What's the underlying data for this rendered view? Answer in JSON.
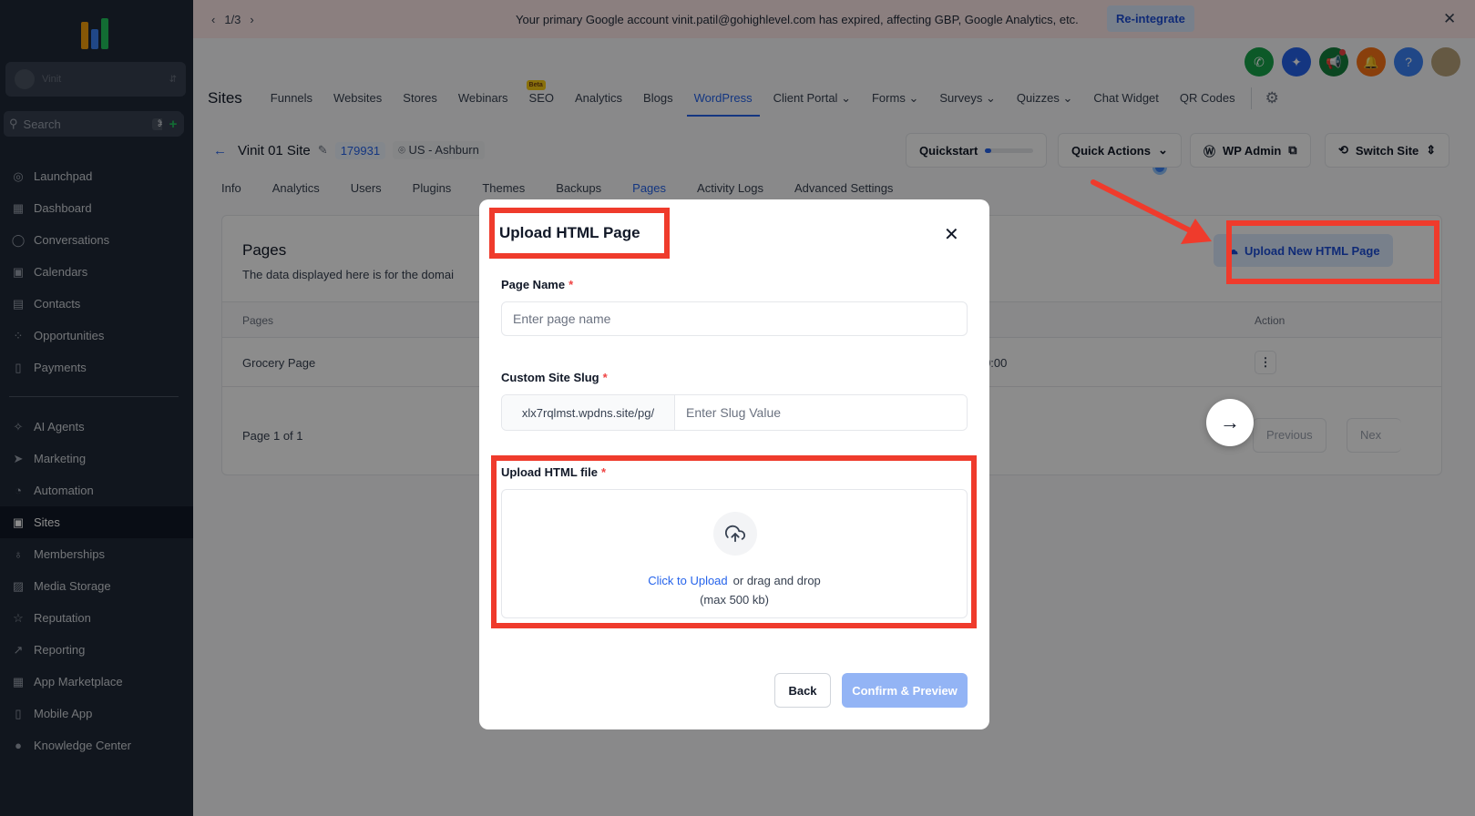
{
  "sidebar": {
    "account": {
      "name": "Vinit",
      "sub": ""
    },
    "search": {
      "placeholder": "Search",
      "shortcut": "⌘K"
    },
    "items": [
      {
        "label": "Launchpad",
        "icon": "rocket-icon"
      },
      {
        "label": "Dashboard",
        "icon": "grid-icon"
      },
      {
        "label": "Conversations",
        "icon": "chat-icon"
      },
      {
        "label": "Calendars",
        "icon": "calendar-icon"
      },
      {
        "label": "Contacts",
        "icon": "contacts-icon"
      },
      {
        "label": "Opportunities",
        "icon": "funnel-icon"
      },
      {
        "label": "Payments",
        "icon": "receipt-icon"
      },
      {
        "label": "AI Agents",
        "icon": "sparkle-icon"
      },
      {
        "label": "Marketing",
        "icon": "send-icon"
      },
      {
        "label": "Automation",
        "icon": "automation-icon"
      },
      {
        "label": "Sites",
        "icon": "globe-icon",
        "active": true
      },
      {
        "label": "Memberships",
        "icon": "award-icon"
      },
      {
        "label": "Media Storage",
        "icon": "image-icon"
      },
      {
        "label": "Reputation",
        "icon": "star-icon"
      },
      {
        "label": "Reporting",
        "icon": "trend-icon"
      },
      {
        "label": "App Marketplace",
        "icon": "apps-icon"
      },
      {
        "label": "Mobile App",
        "icon": "phone-icon"
      },
      {
        "label": "Knowledge Center",
        "icon": "info-icon"
      }
    ]
  },
  "banner": {
    "pager": "1/3",
    "message": "Your primary Google account vinit.patil@gohighlevel.com has expired, affecting GBP, Google Analytics, etc.",
    "action": "Re-integrate"
  },
  "topnav": {
    "title": "Sites",
    "tabs": [
      "Funnels",
      "Websites",
      "Stores",
      "Webinars",
      "SEO",
      "Analytics",
      "Blogs",
      "WordPress",
      "Client Portal",
      "Forms",
      "Surveys",
      "Quizzes",
      "Chat Widget",
      "QR Codes"
    ],
    "active": "WordPress",
    "beta_badge": "Beta"
  },
  "site": {
    "name": "Vinit 01 Site",
    "id": "179931",
    "location": "US - Ashburn",
    "quickstart": "Quickstart",
    "quickstart_progress": 0.12,
    "quick_actions": "Quick Actions",
    "wp_admin": "WP Admin",
    "switch_site": "Switch Site"
  },
  "subtabs": {
    "items": [
      "Info",
      "Analytics",
      "Users",
      "Plugins",
      "Themes",
      "Backups",
      "Pages",
      "Activity Logs",
      "Advanced Settings"
    ],
    "active": "Pages"
  },
  "pages_card": {
    "title": "Pages",
    "description": "The data displayed here is for the domai",
    "upload_button": "Upload New HTML Page",
    "col_pages": "Pages",
    "col_action": "Action",
    "row_name": "Grocery Page",
    "row_time": "0:00:00",
    "pagination": "Page 1 of 1",
    "prev": "Previous",
    "next": "Nex"
  },
  "modal": {
    "title": "Upload HTML Page",
    "page_name_label": "Page Name",
    "page_name_placeholder": "Enter page name",
    "slug_label": "Custom Site Slug",
    "slug_prefix": "xlx7rqlmst.wpdns.site/pg/",
    "slug_placeholder": "Enter Slug Value",
    "file_label": "Upload HTML file",
    "click_upload": "Click to Upload",
    "drag_text": "or drag and drop",
    "max_size": "(max 500 kb)",
    "back": "Back",
    "confirm": "Confirm & Preview",
    "required_mark": "*"
  },
  "colors": {
    "sidebar_bg": "#1f2937",
    "accent": "#2563eb",
    "annotation": "#ef3b2c"
  }
}
